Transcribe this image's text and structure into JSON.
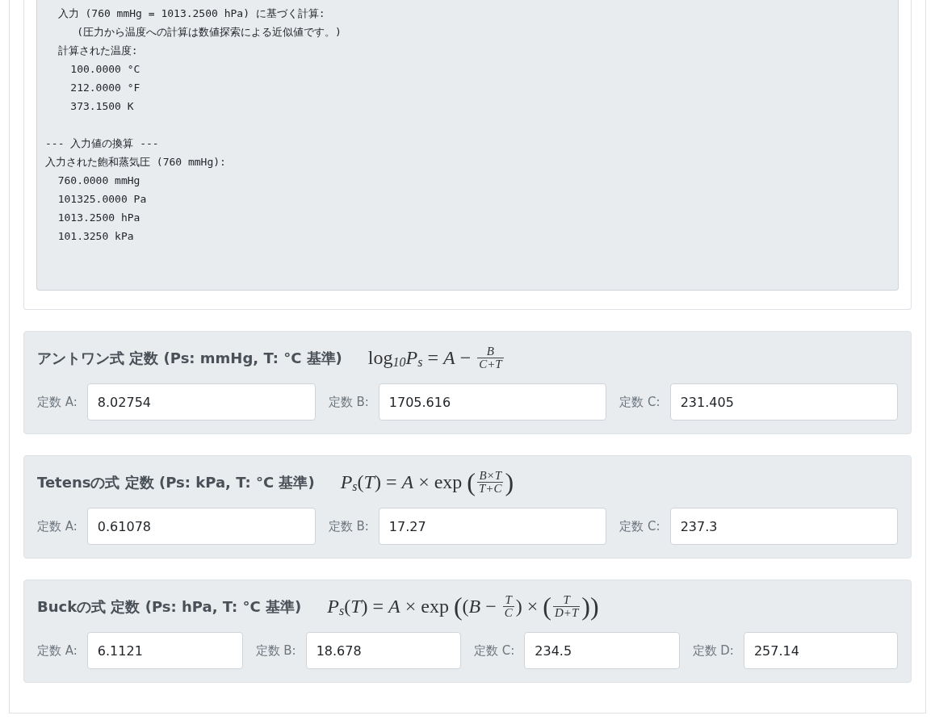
{
  "output_blocks": [
    [
      "  入力 (760 mmHg = 1013.2500 hPa) に基づく計算:",
      "     (圧力から温度への計算は数値探索による近似値です。)",
      "  計算された温度:",
      "    100.0000 °C",
      "    212.0000 °F",
      "    373.1500 K"
    ],
    [
      "--- 入力値の換算 ---",
      "入力された飽和蒸気圧 (760 mmHg):",
      "  760.0000 mmHg",
      "  101325.0000 Pa",
      "  1013.2500 hPa",
      "  101.3250 kPa"
    ]
  ],
  "sections": [
    {
      "title": "アントワン式 定数 (Ps: mmHg, T: °C 基準)",
      "formula": [
        {
          "kind": "text",
          "text": "log"
        },
        {
          "kind": "sub",
          "text": "10"
        },
        {
          "kind": "var",
          "text": "P"
        },
        {
          "kind": "sub",
          "text": "s"
        },
        {
          "kind": "text",
          "text": " = "
        },
        {
          "kind": "var",
          "text": "A"
        },
        {
          "kind": "text",
          "text": " − "
        },
        {
          "kind": "frac",
          "num": "B",
          "den": "C+T"
        }
      ],
      "fields": [
        {
          "label": "定数 A:",
          "value": "8.02754"
        },
        {
          "label": "定数 B:",
          "value": "1705.616"
        },
        {
          "label": "定数 C:",
          "value": "231.405"
        }
      ]
    },
    {
      "title": "Tetensの式 定数 (Ps: kPa, T: °C 基準)",
      "formula": [
        {
          "kind": "var",
          "text": "P"
        },
        {
          "kind": "sub",
          "text": "s"
        },
        {
          "kind": "text",
          "text": "("
        },
        {
          "kind": "var",
          "text": "T"
        },
        {
          "kind": "text",
          "text": ") = "
        },
        {
          "kind": "var",
          "text": "A"
        },
        {
          "kind": "text",
          "text": " × exp "
        },
        {
          "kind": "paren",
          "text": "("
        },
        {
          "kind": "frac",
          "num": "B×T",
          "den": "T+C"
        },
        {
          "kind": "paren",
          "text": ")"
        }
      ],
      "fields": [
        {
          "label": "定数 A:",
          "value": "0.61078"
        },
        {
          "label": "定数 B:",
          "value": "17.27"
        },
        {
          "label": "定数 C:",
          "value": "237.3"
        }
      ]
    },
    {
      "title": "Buckの式 定数 (Ps: hPa, T: °C 基準)",
      "formula": [
        {
          "kind": "var",
          "text": "P"
        },
        {
          "kind": "sub",
          "text": "s"
        },
        {
          "kind": "text",
          "text": "("
        },
        {
          "kind": "var",
          "text": "T"
        },
        {
          "kind": "text",
          "text": ") = "
        },
        {
          "kind": "var",
          "text": "A"
        },
        {
          "kind": "text",
          "text": " × exp "
        },
        {
          "kind": "paren",
          "text": "("
        },
        {
          "kind": "text",
          "text": "("
        },
        {
          "kind": "var",
          "text": "B"
        },
        {
          "kind": "text",
          "text": " − "
        },
        {
          "kind": "frac",
          "num": "T",
          "den": "C"
        },
        {
          "kind": "text",
          "text": ") × "
        },
        {
          "kind": "paren",
          "text": "("
        },
        {
          "kind": "frac",
          "num": "T",
          "den": "D+T"
        },
        {
          "kind": "paren",
          "text": ")"
        },
        {
          "kind": "paren",
          "text": ")"
        }
      ],
      "fields": [
        {
          "label": "定数 A:",
          "value": "6.1121"
        },
        {
          "label": "定数 B:",
          "value": "18.678"
        },
        {
          "label": "定数 C:",
          "value": "234.5"
        },
        {
          "label": "定数 D:",
          "value": "257.14"
        }
      ]
    }
  ]
}
